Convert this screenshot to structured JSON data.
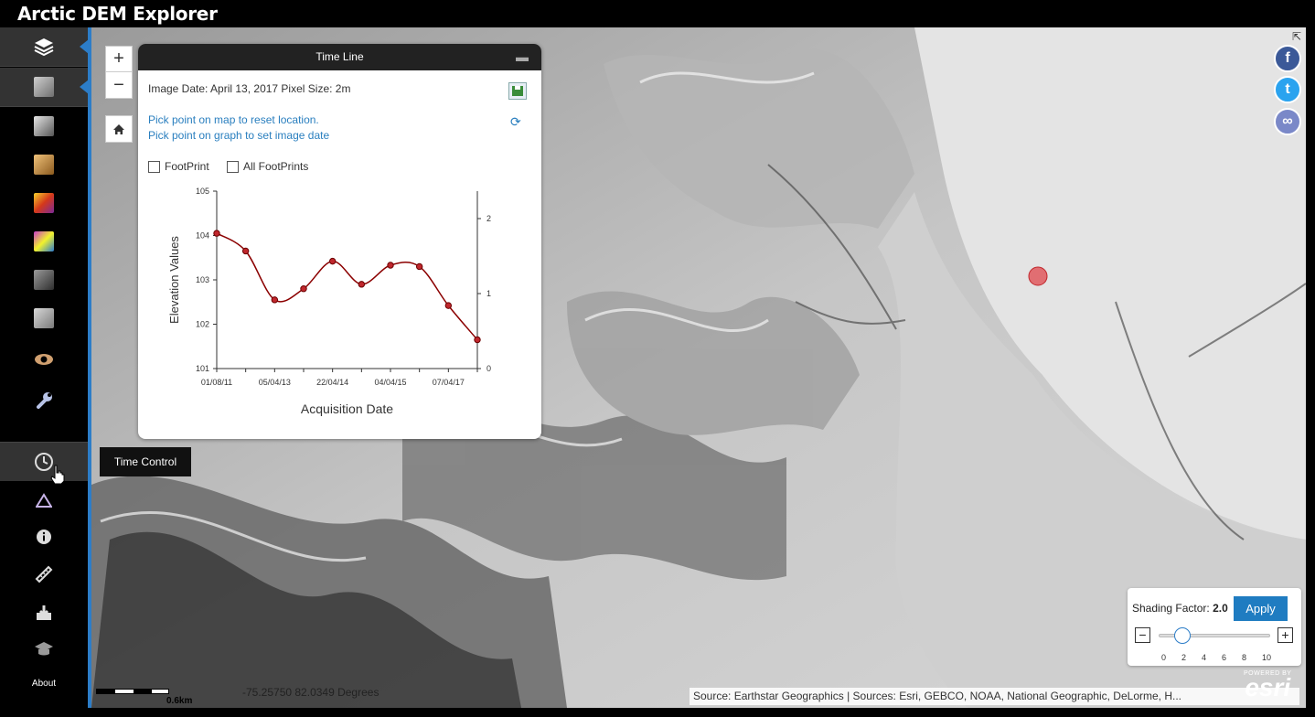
{
  "header": {
    "title": "Arctic DEM Explorer"
  },
  "sidebar": {
    "items": [
      {
        "name": "layers-icon"
      },
      {
        "name": "renderer-hillshade",
        "colors": [
          "#cfcfcf",
          "#6f6f6f"
        ]
      },
      {
        "name": "renderer-multidirectional-hillshade",
        "colors": [
          "#e6e6e6",
          "#555555"
        ]
      },
      {
        "name": "renderer-tinted-hillshade",
        "colors": [
          "#f0c27a",
          "#8b5a1e"
        ]
      },
      {
        "name": "renderer-aspect",
        "colors": [
          "#f7d02a",
          "#d4381a"
        ]
      },
      {
        "name": "renderer-slope",
        "colors": [
          "#c83cc8",
          "#f2f22c"
        ]
      },
      {
        "name": "renderer-contour",
        "colors": [
          "#9a9a9a",
          "#2e2e2e"
        ]
      },
      {
        "name": "renderer-ellipsoidal",
        "colors": [
          "#d8d8d8",
          "#7a7a7a"
        ]
      },
      {
        "name": "eye-icon"
      },
      {
        "name": "wrench-icon"
      },
      {
        "name": "clock-icon"
      },
      {
        "name": "triangle-icon"
      },
      {
        "name": "info-icon"
      },
      {
        "name": "ruler-icon"
      },
      {
        "name": "download-icon"
      },
      {
        "name": "graduation-cap-icon"
      }
    ],
    "about_label": "About"
  },
  "tooltip": {
    "text": "Time Control"
  },
  "timeline": {
    "title": "Time Line",
    "info": "Image Date: April 13, 2017 Pixel Size: 2m",
    "link1": "Pick point on map to reset location.",
    "link2": "Pick point on graph to set image date",
    "checkbox1": "FootPrint",
    "checkbox2": "All FootPrints"
  },
  "chart_data": {
    "type": "line",
    "xlabel": "Acquisition Date",
    "ylabel": "Elevation Values",
    "ylim": [
      101,
      105
    ],
    "yticks": [
      "101",
      "102",
      "103",
      "104",
      "105"
    ],
    "y2ticks": [
      "0",
      "1",
      "2"
    ],
    "xticks": [
      "01/08/11",
      "05/04/13",
      "22/04/14",
      "04/04/15",
      "07/04/17"
    ],
    "series": [
      {
        "color": "#8b0000",
        "values": [
          104.05,
          103.65,
          102.55,
          102.8,
          103.42,
          102.9,
          103.33,
          103.3,
          102.42,
          101.65
        ]
      }
    ]
  },
  "shading": {
    "label": "Shading Factor: ",
    "value": "2.0",
    "apply_label": "Apply",
    "minus": "−",
    "plus": "+",
    "ticks": [
      "0",
      "2",
      "4",
      "6",
      "8",
      "10"
    ],
    "level": 2
  },
  "map": {
    "zoom_in": "+",
    "zoom_out": "−",
    "coords": "-75.25750 82.0349 Degrees",
    "scale_label": "0.6km",
    "attribution": "Source: Earthstar Geographics | Sources: Esri, GEBCO, NOAA, National Geographic, DeLorme, H...",
    "esri_powered": "POWERED BY",
    "esri_name": "esri"
  },
  "social": {
    "facebook": "f",
    "twitter": "t",
    "link": "∞"
  }
}
